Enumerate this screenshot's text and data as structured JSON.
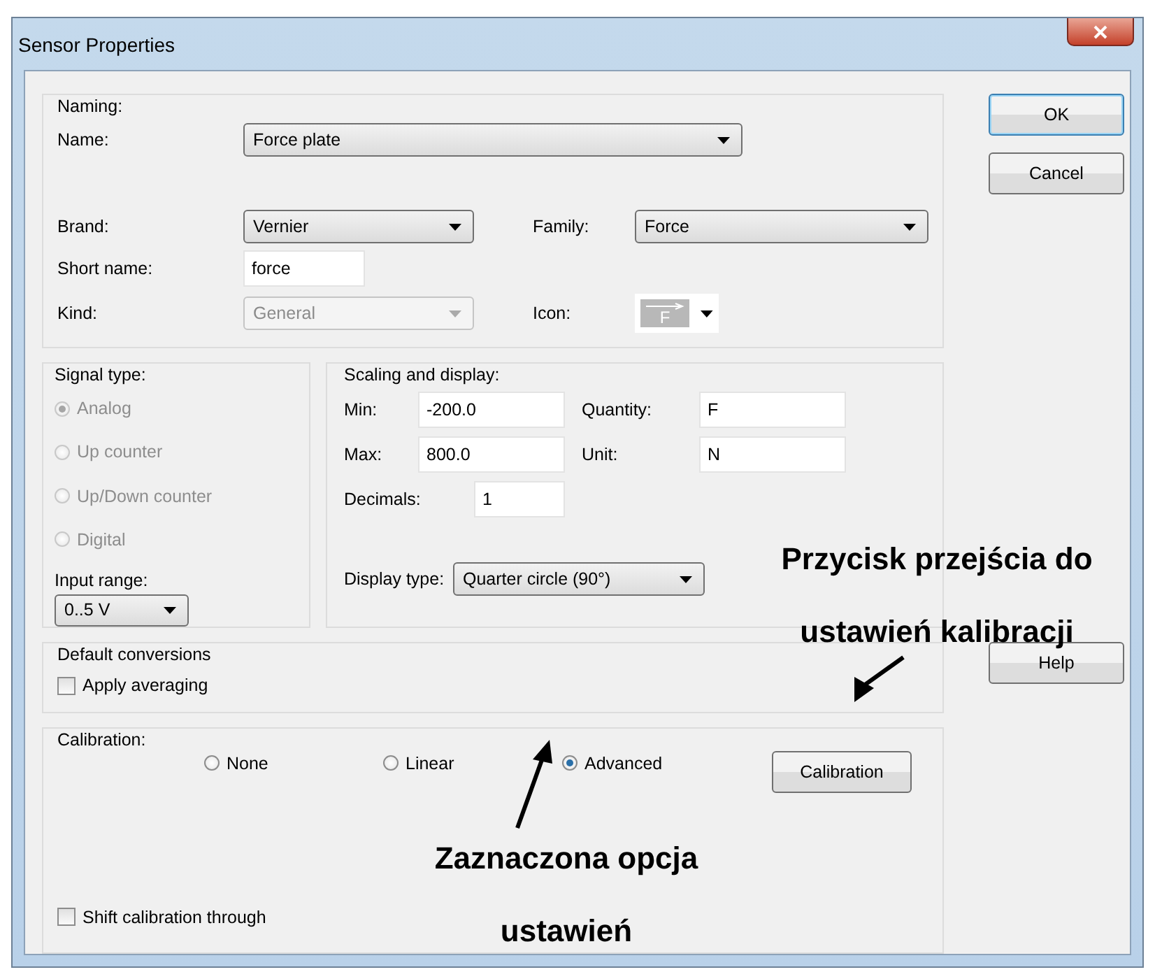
{
  "window": {
    "title": "Sensor Properties"
  },
  "naming": {
    "legend": "Naming:",
    "name": {
      "label": "Name:",
      "value": "Force plate"
    },
    "brand": {
      "label": "Brand:",
      "value": "Vernier"
    },
    "family": {
      "label": "Family:",
      "value": "Force"
    },
    "short_name": {
      "label": "Short name:",
      "value": "force"
    },
    "kind": {
      "label": "Kind:",
      "value": "General",
      "disabled": true
    },
    "icon": {
      "label": "Icon:",
      "glyph": "F"
    }
  },
  "signal_type": {
    "legend": "Signal type:",
    "options": [
      {
        "label": "Analog",
        "selected": true,
        "disabled": true
      },
      {
        "label": "Up counter",
        "selected": false,
        "disabled": true
      },
      {
        "label": "Up/Down counter",
        "selected": false,
        "disabled": true
      },
      {
        "label": "Digital",
        "selected": false,
        "disabled": true
      }
    ],
    "input_range": {
      "label": "Input range:",
      "value": "0..5 V"
    }
  },
  "scaling": {
    "legend": "Scaling and display:",
    "min": {
      "label": "Min:",
      "value": "-200.0"
    },
    "quantity": {
      "label": "Quantity:",
      "value": "F"
    },
    "max": {
      "label": "Max:",
      "value": "800.0"
    },
    "unit": {
      "label": "Unit:",
      "value": "N"
    },
    "decimals": {
      "label": "Decimals:",
      "value": "1"
    },
    "display_type": {
      "label": "Display type:",
      "value": "Quarter circle (90°)"
    }
  },
  "default_conversions": {
    "legend": "Default conversions",
    "apply_averaging": {
      "label": "Apply averaging",
      "checked": false
    }
  },
  "calibration": {
    "legend": "Calibration:",
    "options": [
      {
        "label": "None",
        "selected": false
      },
      {
        "label": "Linear",
        "selected": false
      },
      {
        "label": "Advanced",
        "selected": true
      }
    ],
    "button": "Calibration",
    "shift": {
      "label": "Shift calibration through",
      "checked": false
    }
  },
  "buttons": [
    {
      "label": "OK",
      "default": true
    },
    {
      "label": "Cancel",
      "default": false
    },
    {
      "label": "Help",
      "default": false
    }
  ],
  "annotations": [
    {
      "lines": [
        "Przycisk przejścia do",
        "ustawień kalibracji"
      ]
    },
    {
      "lines": [
        "Zaznaczona opcja",
        "ustawień"
      ]
    }
  ]
}
